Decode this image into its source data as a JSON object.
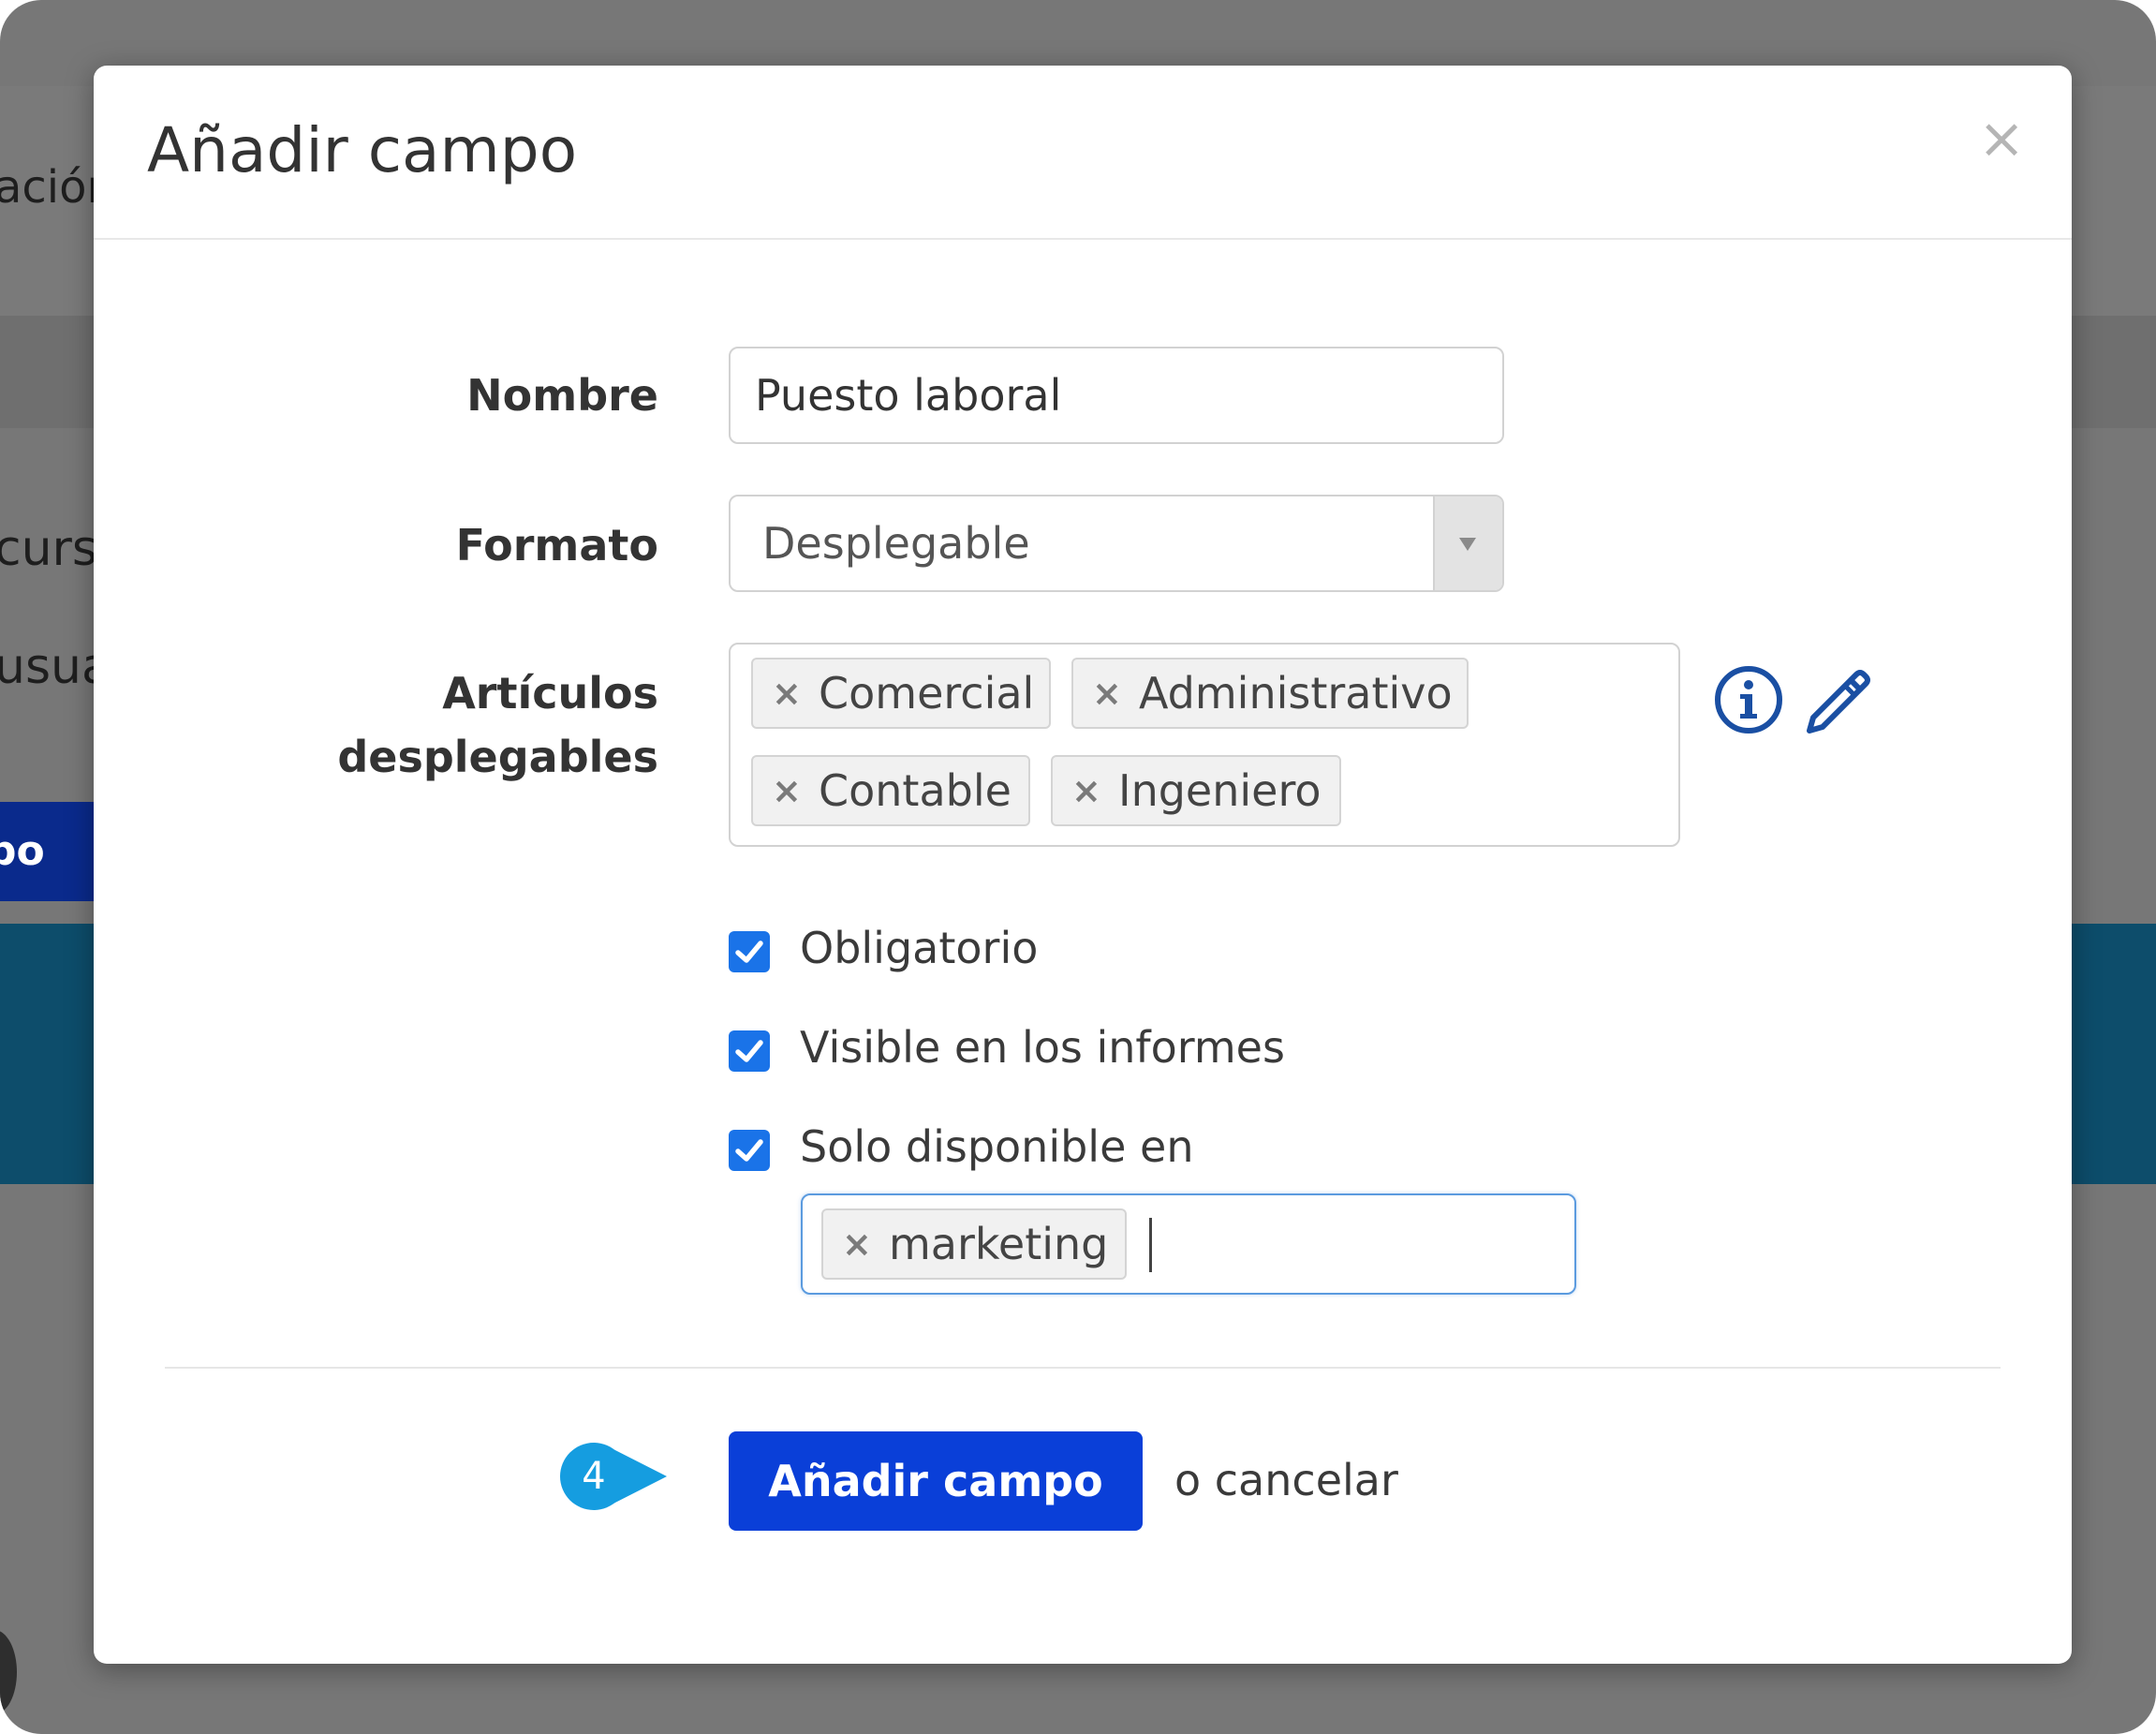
{
  "background": {
    "frag_1": "ación",
    "frag_2": "curs",
    "frag_3": "usua",
    "frag_4": "po"
  },
  "modal": {
    "title": "Añadir campo",
    "close_symbol": "×"
  },
  "form": {
    "name_label": "Nombre",
    "name_value": "Puesto laboral",
    "format_label": "Formato",
    "format_value": "Desplegable",
    "items_label_1": "Artículos",
    "items_label_2": "desplegables",
    "items": [
      "Comercial",
      "Administrativo",
      "Contable",
      "Ingeniero"
    ],
    "tag_remove_symbol": "×",
    "icons": [
      "info-icon",
      "pencil-icon"
    ],
    "checkboxes": [
      {
        "label": "Obligatorio",
        "checked": true
      },
      {
        "label": "Visible en los informes",
        "checked": true
      },
      {
        "label": "Solo disponible en",
        "checked": true
      }
    ],
    "available_tags": [
      "marketing"
    ]
  },
  "footer": {
    "step_number": "4",
    "submit_label": "Añadir campo",
    "cancel_label": "o cancelar"
  },
  "colors": {
    "primary": "#0a3fd8",
    "checkbox": "#1a73e8",
    "badge": "#159de0",
    "icon_blue": "#1a4fa3",
    "overlay": "#777777"
  }
}
